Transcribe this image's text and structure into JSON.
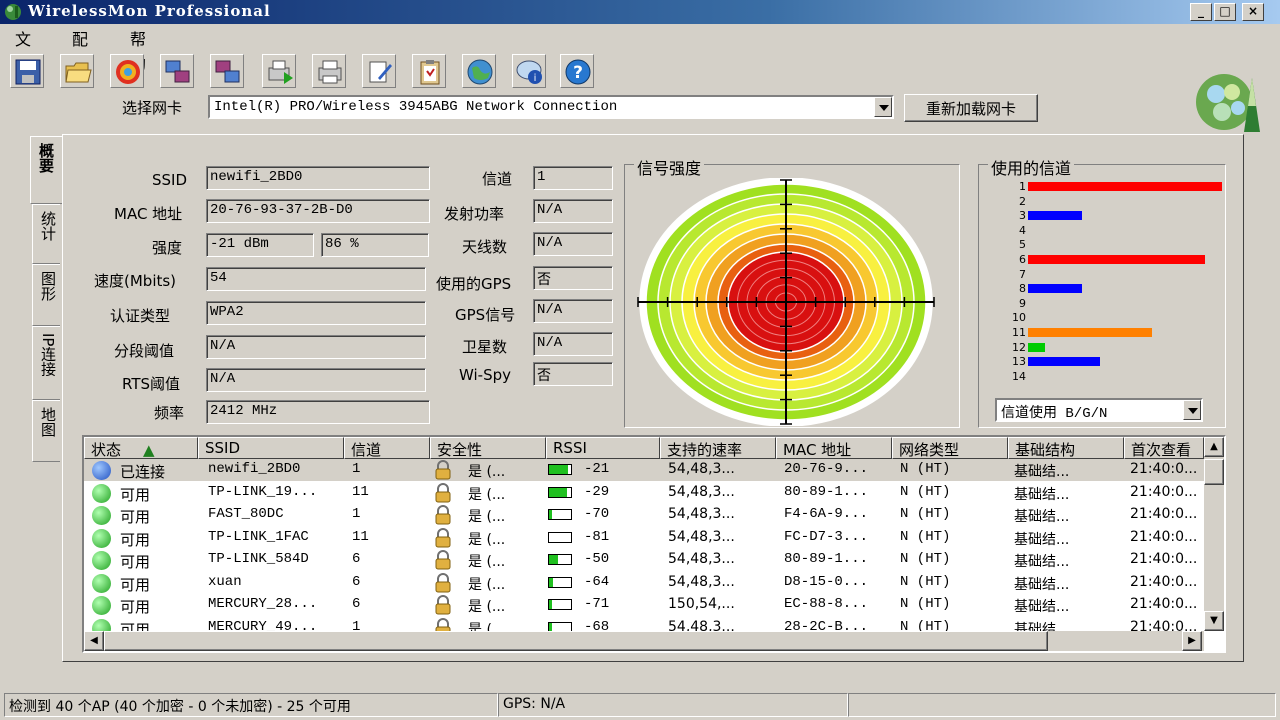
{
  "window": {
    "title": "WirelessMon Professional",
    "min_glyph": "_",
    "max_glyph": "□",
    "close_glyph": "×"
  },
  "menu": [
    "文件",
    "配置",
    "帮助"
  ],
  "toolbar": [
    "save-icon",
    "open-folder-icon",
    "target-icon",
    "network-cards-icon",
    "network-cards-alt-icon",
    "print-green-icon",
    "print-icon",
    "document-pen-icon",
    "clipboard-icon",
    "globe-icon",
    "help-bubble-icon",
    "question-icon"
  ],
  "adapter": {
    "label": "选择网卡",
    "value": "Intel(R) PRO/Wireless 3945ABG Network Connection",
    "reload_label": "重新加载网卡"
  },
  "tabs": [
    "概要",
    "统计",
    "图形",
    "IP连接",
    "地图"
  ],
  "summary": {
    "ssid_label": "SSID",
    "ssid": "newifi_2BD0",
    "mac_label": "MAC 地址",
    "mac": "20-76-93-37-2B-D0",
    "strength_label": "强度",
    "strength_dbm": "-21 dBm",
    "strength_pct": "86 %",
    "speed_label": "速度(Mbits)",
    "speed": "54",
    "auth_label": "认证类型",
    "auth": "WPA2",
    "frag_label": "分段阈值",
    "frag": "N/A",
    "rts_label": "RTS阈值",
    "rts": "N/A",
    "freq_label": "频率",
    "freq": "2412 MHz",
    "channel_label": "信道",
    "channel": "1",
    "txpower_label": "发射功率",
    "txpower": "N/A",
    "antenna_label": "天线数",
    "antenna": "N/A",
    "gps_used_label": "使用的GPS",
    "gps_used": "否",
    "gps_signal_label": "GPS信号",
    "gps_signal": "N/A",
    "satellites_label": "卫星数",
    "satellites": "N/A",
    "wispy_label": "Wi-Spy",
    "wispy": "否"
  },
  "signal": {
    "title": "信号强度"
  },
  "channels": {
    "title": "使用的信道",
    "select_value": "信道使用 B/G/N",
    "labels": [
      "1",
      "2",
      "3",
      "4",
      "5",
      "6",
      "7",
      "8",
      "9",
      "10",
      "11",
      "12",
      "13",
      "14"
    ],
    "usage": [
      1.0,
      0,
      0.28,
      0,
      0,
      0.91,
      0,
      0.28,
      0,
      0,
      0.64,
      0.09,
      0.37,
      0
    ],
    "colors": [
      "#ff0000",
      "#0000ff",
      "#0000ff",
      "#0000ff",
      "#0000ff",
      "#ff0000",
      "#0000ff",
      "#0000ff",
      "#0000ff",
      "#0000ff",
      "#ff8000",
      "#00cc00",
      "#0000ff",
      "#0000ff"
    ]
  },
  "table": {
    "sort_arrow": "▲",
    "headers": [
      "状态",
      "SSID",
      "信道",
      "安全性",
      "RSSI",
      "支持的速率",
      "MAC 地址",
      "网络类型",
      "基础结构",
      "首次查看"
    ],
    "rows": [
      {
        "status": "已连接",
        "ssid": "newifi_2BD0",
        "channel": "1",
        "security": "是 (...",
        "rssi": "-21",
        "rssi_level": 0.85,
        "rates": "54,48,3...",
        "mac": "20-76-9...",
        "type": "N (HT)",
        "infra": "基础结...",
        "first": "21:40:0...",
        "dot": "blue"
      },
      {
        "status": "可用",
        "ssid": "TP-LINK_19...",
        "channel": "11",
        "security": "是 (...",
        "rssi": "-29",
        "rssi_level": 0.8,
        "rates": "54,48,3...",
        "mac": "80-89-1...",
        "type": "N (HT)",
        "infra": "基础结...",
        "first": "21:40:0...",
        "dot": "green"
      },
      {
        "status": "可用",
        "ssid": "FAST_80DC",
        "channel": "1",
        "security": "是 (...",
        "rssi": "-70",
        "rssi_level": 0.15,
        "rates": "54,48,3...",
        "mac": "F4-6A-9...",
        "type": "N (HT)",
        "infra": "基础结...",
        "first": "21:40:0...",
        "dot": "green"
      },
      {
        "status": "可用",
        "ssid": "TP-LINK_1FAC",
        "channel": "11",
        "security": "是 (...",
        "rssi": "-81",
        "rssi_level": 0.0,
        "rates": "54,48,3...",
        "mac": "FC-D7-3...",
        "type": "N (HT)",
        "infra": "基础结...",
        "first": "21:40:0...",
        "dot": "green"
      },
      {
        "status": "可用",
        "ssid": "TP-LINK_584D",
        "channel": "6",
        "security": "是 (...",
        "rssi": "-50",
        "rssi_level": 0.4,
        "rates": "54,48,3...",
        "mac": "80-89-1...",
        "type": "N (HT)",
        "infra": "基础结...",
        "first": "21:40:0...",
        "dot": "green"
      },
      {
        "status": "可用",
        "ssid": "xuan",
        "channel": "6",
        "security": "是 (...",
        "rssi": "-64",
        "rssi_level": 0.2,
        "rates": "54,48,3...",
        "mac": "D8-15-0...",
        "type": "N (HT)",
        "infra": "基础结...",
        "first": "21:40:0...",
        "dot": "green"
      },
      {
        "status": "可用",
        "ssid": "MERCURY_28...",
        "channel": "6",
        "security": "是 (...",
        "rssi": "-71",
        "rssi_level": 0.12,
        "rates": "150,54,...",
        "mac": "EC-88-8...",
        "type": "N (HT)",
        "infra": "基础结...",
        "first": "21:40:0...",
        "dot": "green"
      },
      {
        "status": "可用",
        "ssid": "MERCURY_49...",
        "channel": "1",
        "security": "是 (...",
        "rssi": "-68",
        "rssi_level": 0.15,
        "rates": "54,48,3...",
        "mac": "28-2C-B...",
        "type": "N (HT)",
        "infra": "基础结...",
        "first": "21:40:0...",
        "dot": "green"
      }
    ]
  },
  "statusbar": {
    "ap_summary": "检测到 40 个AP (40 个加密 - 0 个未加密) - 25 个可用",
    "gps": "GPS: N/A"
  },
  "colors": {
    "title_start": "#0a246a",
    "title_end": "#a6caf0",
    "face": "#d4d0c8"
  }
}
